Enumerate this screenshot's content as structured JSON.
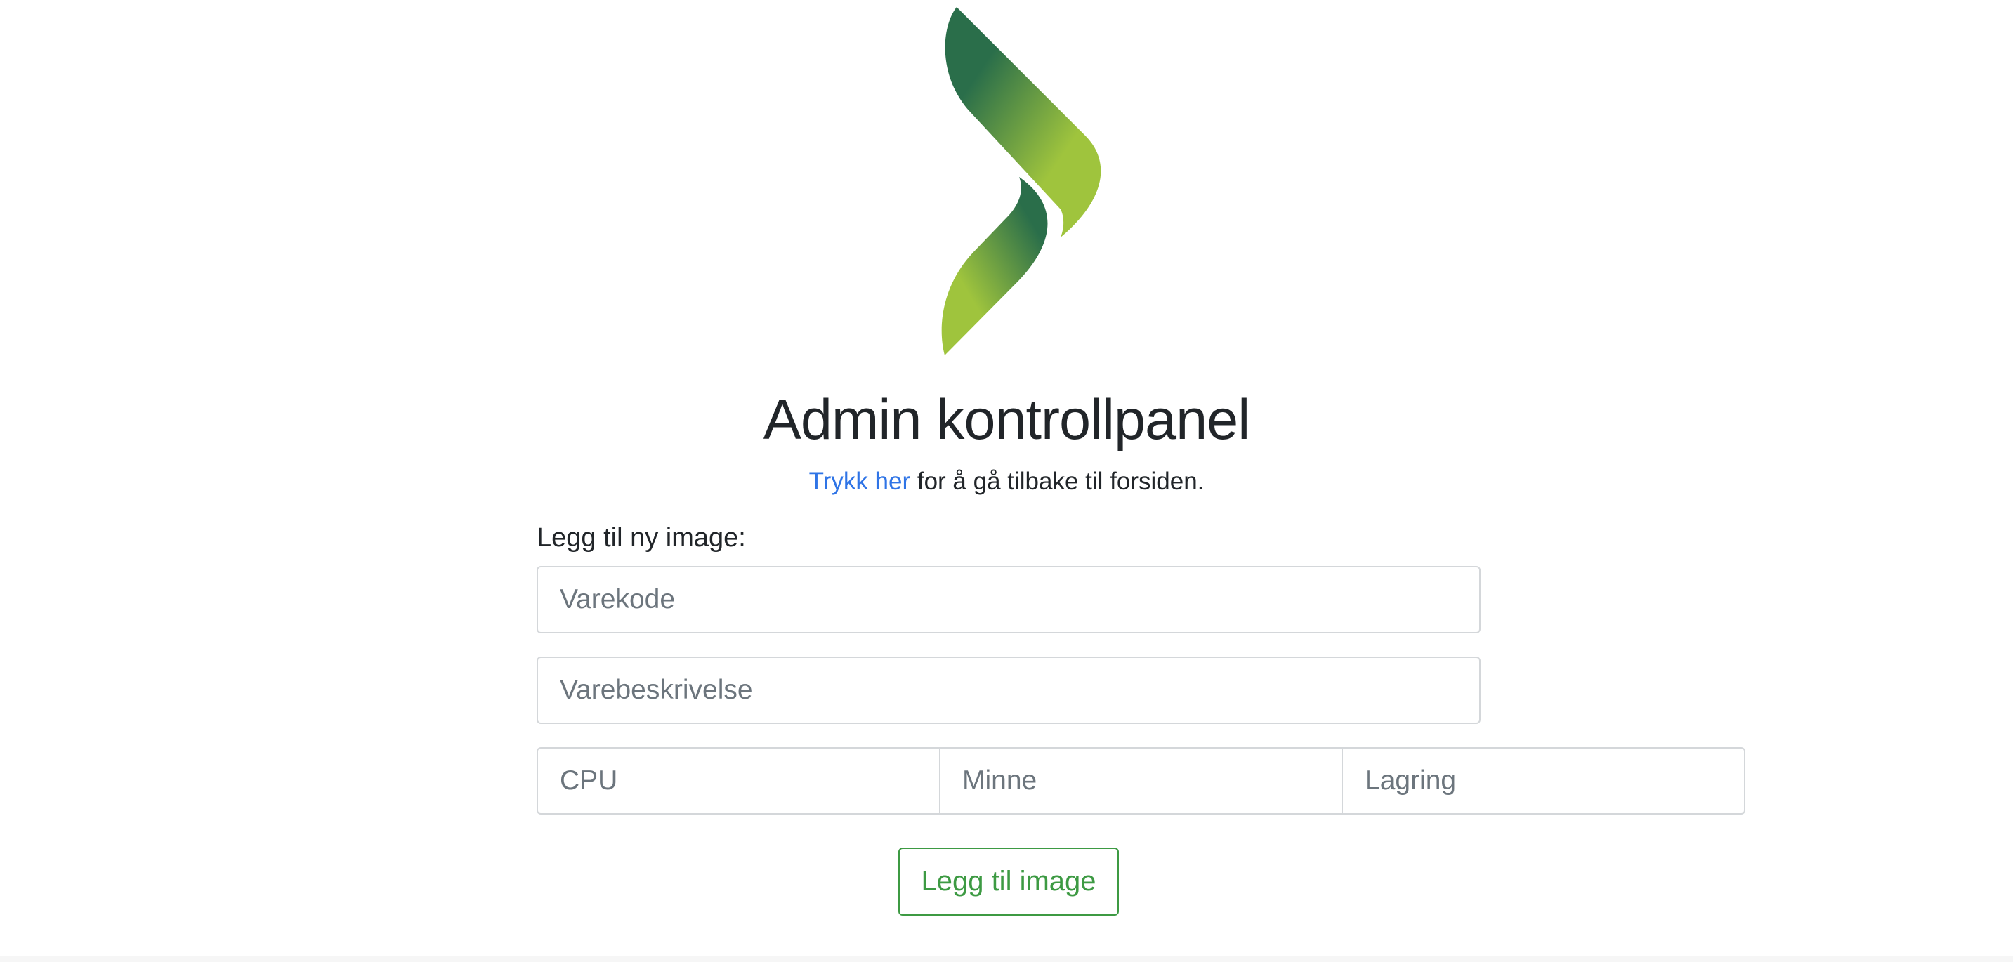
{
  "header": {
    "title": "Admin kontrollpanel",
    "back_link_text": "Trykk her",
    "back_text_suffix": " for å gå tilbake til forsiden."
  },
  "form": {
    "section_label": "Legg til ny image:",
    "fields": {
      "varekode": {
        "placeholder": "Varekode",
        "value": ""
      },
      "varebeskrivelse": {
        "placeholder": "Varebeskrivelse",
        "value": ""
      },
      "cpu": {
        "placeholder": "CPU",
        "value": ""
      },
      "minne": {
        "placeholder": "Minne",
        "value": ""
      },
      "lagring": {
        "placeholder": "Lagring",
        "value": ""
      }
    },
    "submit_label": "Legg til image"
  },
  "logo": {
    "icon": "green-chevron-logo-icon",
    "colors": {
      "dark": "#2a6e4a",
      "light": "#9fc43d"
    }
  },
  "colors": {
    "link": "#2f74e6",
    "success": "#3d9a43",
    "text": "#212529",
    "placeholder": "#6c757d",
    "border": "#d4d7da"
  }
}
